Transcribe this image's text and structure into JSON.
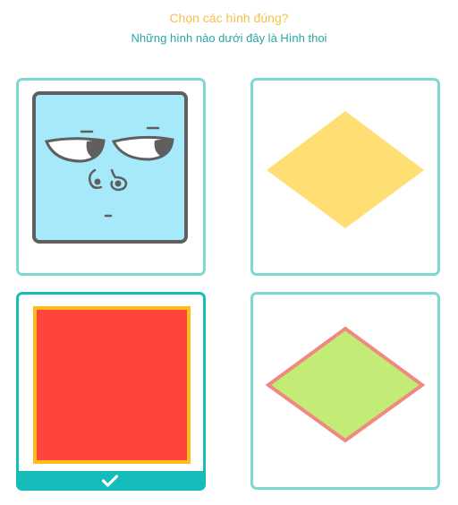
{
  "header": {
    "title": "Chọn các hình đúng?",
    "subtitle": "Những hình nào dưới đây là Hình thoi"
  },
  "options": [
    {
      "shape": "cartoon-square-face",
      "selected": false
    },
    {
      "shape": "yellow-rhombus",
      "selected": false
    },
    {
      "shape": "red-square",
      "selected": true
    },
    {
      "shape": "green-rhombus",
      "selected": false
    }
  ],
  "colors": {
    "title": "#f5c048",
    "subtitle": "#2aa6a8",
    "card_border": "#7dd8d3",
    "selected": "#16bcb9",
    "face_fill": "#a6e9fb",
    "face_outline": "#5f5f5f",
    "yellow_rhombus": "#ffdf73",
    "red_square": "#ff4439",
    "red_square_border": "#fdbd1b",
    "green_rhombus": "#c2ec75",
    "green_rhombus_border": "#f08a7e"
  },
  "icons": {
    "selected_indicator": "checkmark-icon"
  }
}
